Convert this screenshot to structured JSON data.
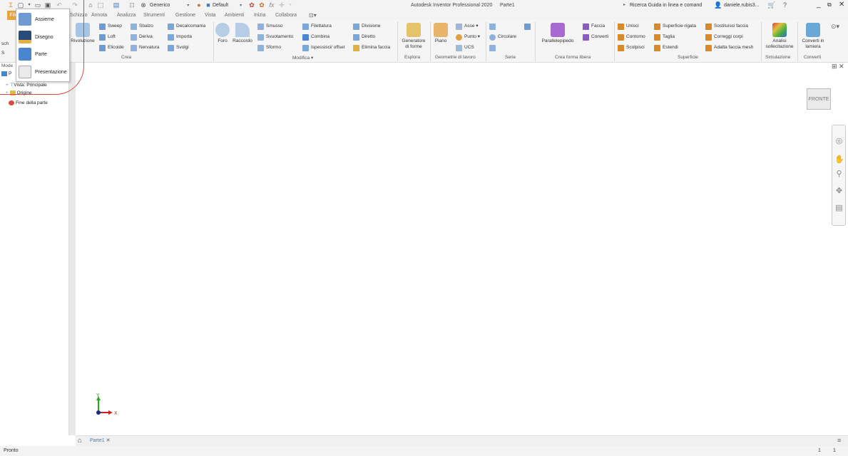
{
  "title_bar": {
    "app_title": "Autodesk Inventor Professional 2020",
    "doc_title": "Parte1",
    "appearance_combo": "Generico",
    "material_combo": "Default",
    "search_placeholder": "Ricerca Guida in linea e comand",
    "user_name": "daniele.rubis3..."
  },
  "tabs": {
    "file": "File",
    "items": [
      "Schizzo",
      "Annota",
      "Analizza",
      "Strumenti",
      "Gestione",
      "Vista",
      "Ambienti",
      "Inizia",
      "Collabora"
    ]
  },
  "ribbon": {
    "left_partial": {
      "top": "Avvia",
      "mid": "2D",
      "sch": "sch",
      "s": "S"
    },
    "crea": {
      "label": "Crea",
      "rivoluzione": "Rivoluzione",
      "col1": [
        "Sweep",
        "Loft",
        "Elicoide"
      ],
      "col2": [
        "Sbalzo",
        "Deriva",
        "Nervatura"
      ],
      "col3": [
        "Decalcomania",
        "Importa",
        "Svolgi"
      ]
    },
    "modifica": {
      "label": "Modifica ▾",
      "foro": "Foro",
      "raccordo": "Raccordo",
      "col1": [
        "Smusso",
        "Svuotamento",
        "Sformo"
      ],
      "col2": [
        "Filettatura",
        "Combina",
        "Ispessisci/ offset"
      ],
      "col3": [
        "Divisione",
        "Diretto",
        "Elimina faccia"
      ]
    },
    "esplora": {
      "label": "Esplora",
      "generatore": "Generatore",
      "di_forme": "di forme"
    },
    "geometrie": {
      "label": "Geometrie di lavoro",
      "piano": "Piano",
      "col": [
        "Asse ▾",
        "Punto ▾",
        "UCS"
      ]
    },
    "serie": {
      "label": "Serie",
      "circolare": "Circolare"
    },
    "forma_libera": {
      "label": "Crea forma libera",
      "parallelepipedo": "Parallelepipedo",
      "col": [
        "Faccia",
        "Converti"
      ]
    },
    "superficie": {
      "label": "Superficie",
      "col1": [
        "Unisci",
        "Contorno",
        "Scolpisci"
      ],
      "col2": [
        "Superficie rigata",
        "Taglia",
        "Estendi"
      ],
      "col3": [
        "Sostituisci faccia",
        "Correggi corpi",
        "Adatta faccia mesh"
      ]
    },
    "simulazione": {
      "label": "Simulazione",
      "analisi": "Analisi",
      "sollecitazione": "sollecitazione"
    },
    "converti": {
      "label": "Converti",
      "converti_in": "Converti in",
      "lamiera": "lamiera"
    }
  },
  "new_menu": {
    "items": [
      "Assieme",
      "Disegno",
      "Parte",
      "Presentazione"
    ]
  },
  "browser": {
    "header": "Mode",
    "tree": [
      "Vista: Principale",
      "Origine",
      "Fine della parte"
    ]
  },
  "viewport": {
    "viewcube_face": "FRONTE",
    "axis_x": "X",
    "axis_y": "Y"
  },
  "doc_tabs": {
    "active": "Parte1"
  },
  "status": {
    "left": "Pronto",
    "right1": "1",
    "right2": "1"
  },
  "colors": {
    "file_tab": "#e8a33b",
    "annotation_circle": "#d84a3b",
    "axis_x": "#cc2222",
    "axis_y": "#22aa22",
    "origin": "#1a2a8a"
  }
}
